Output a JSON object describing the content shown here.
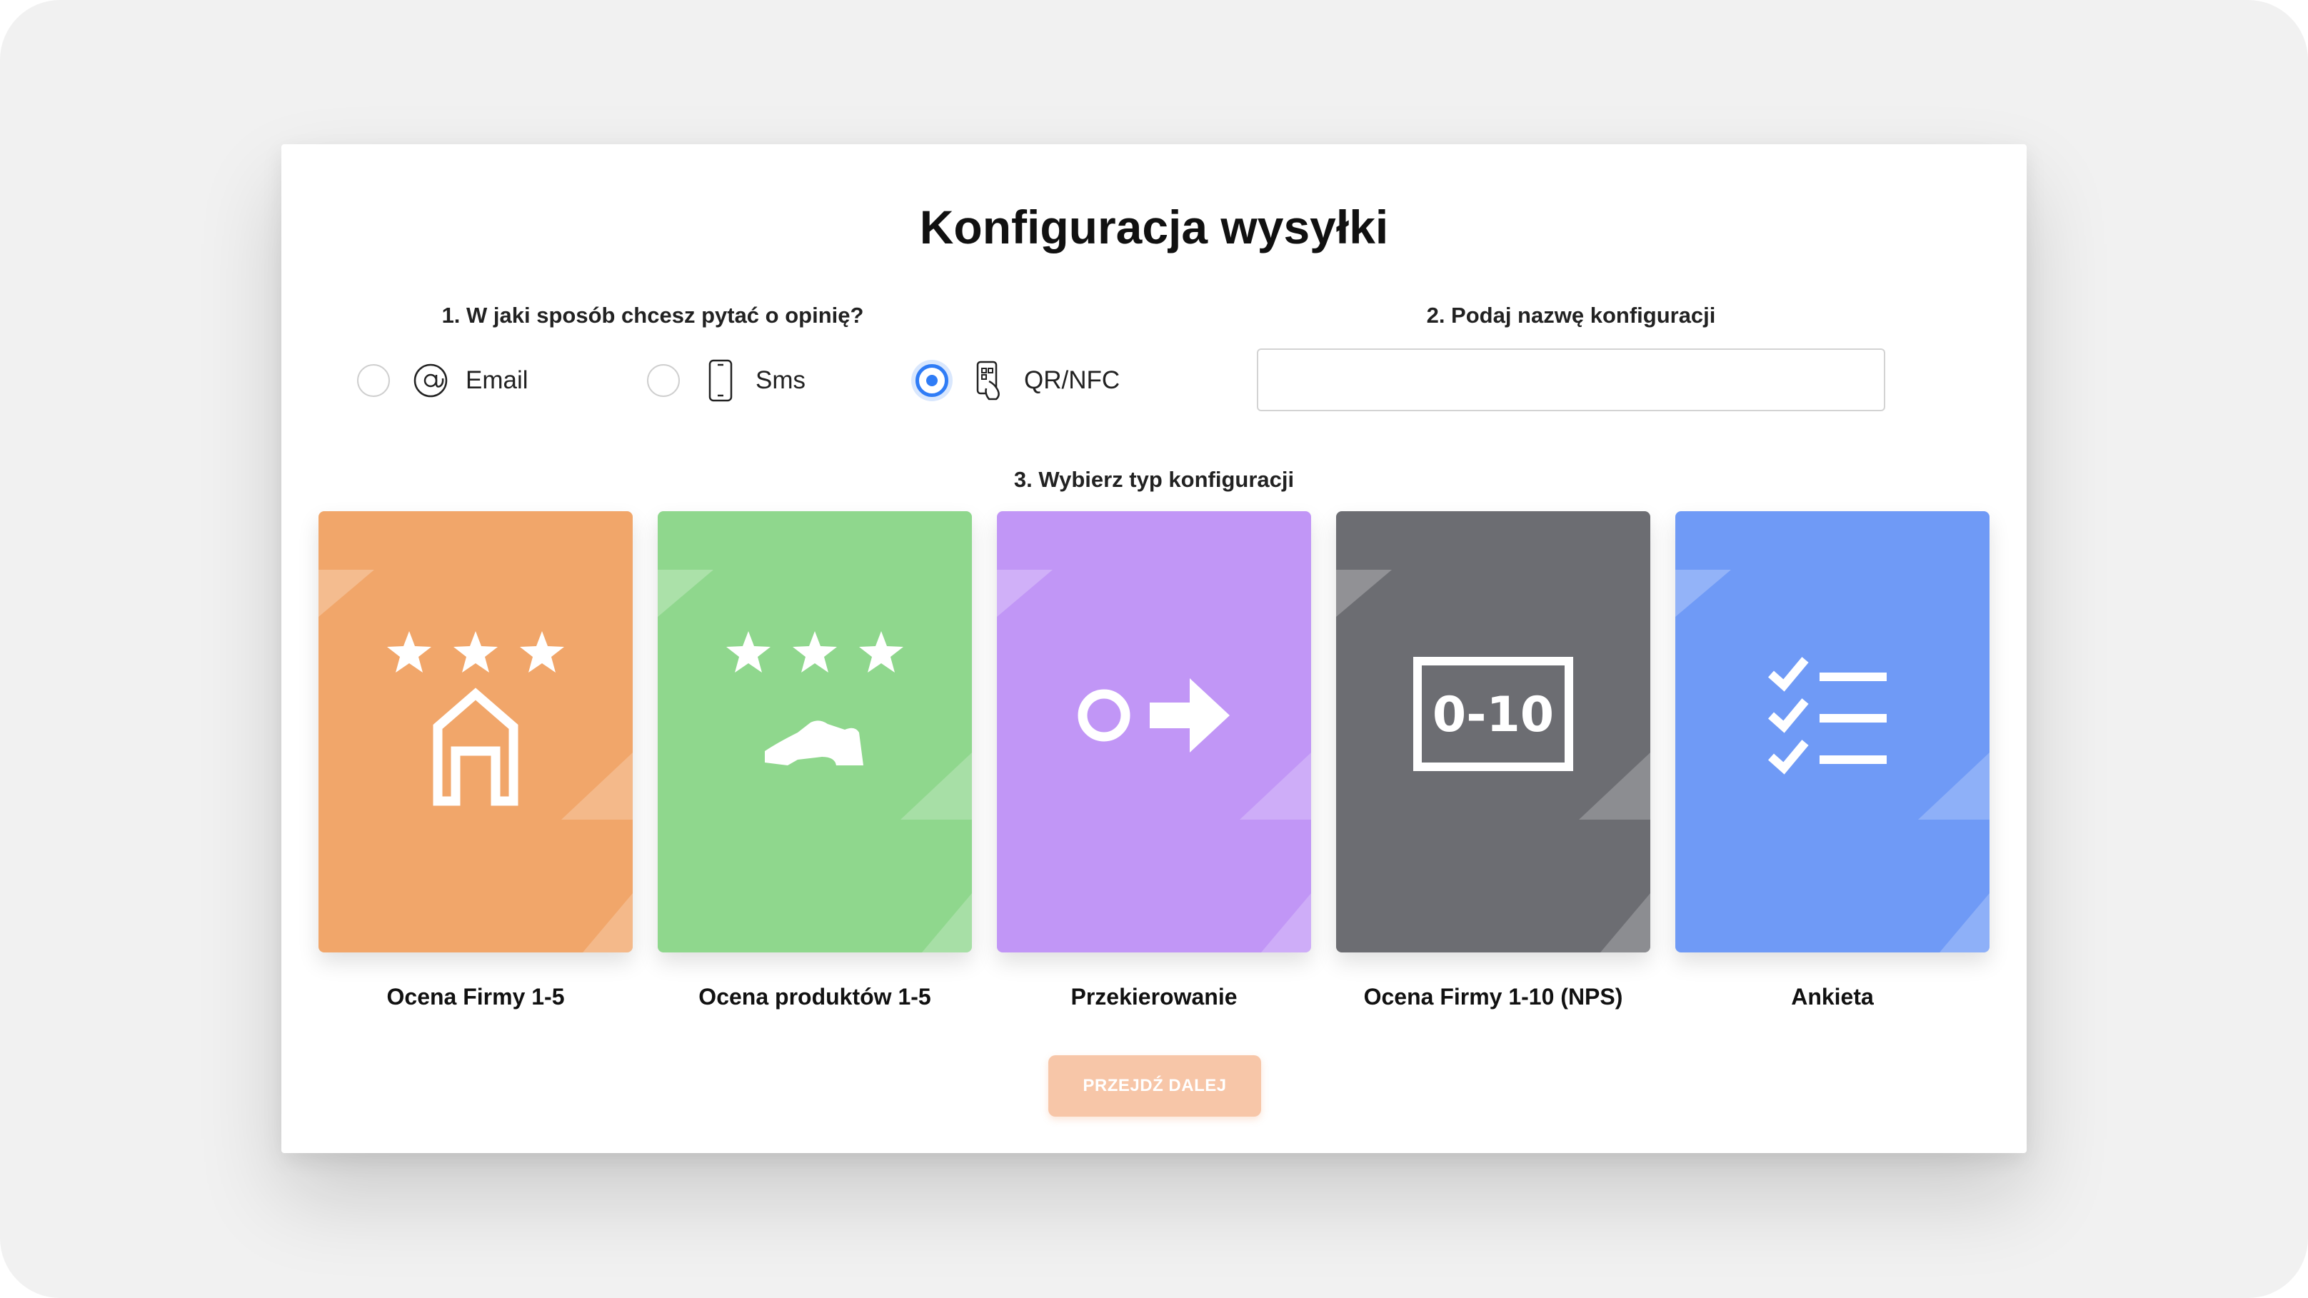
{
  "modal": {
    "title": "Konfiguracja wysyłki",
    "step1_label": "1. W jaki sposób chcesz pytać o opinię?",
    "step2_label": "2. Podaj nazwę konfiguracji",
    "step3_label": "3. Wybierz typ konfiguracji",
    "name_input": {
      "value": "",
      "placeholder": ""
    },
    "next_button": "PRZEJDŹ DALEJ"
  },
  "channels": [
    {
      "label": "Email",
      "icon": "at-sign-icon",
      "selected": false
    },
    {
      "label": "Sms",
      "icon": "smartphone-icon",
      "selected": false
    },
    {
      "label": "QR/NFC",
      "icon": "qr-phone-icon",
      "selected": true
    }
  ],
  "config_types": [
    {
      "label": "Ocena Firmy 1-5",
      "color": "#f1a66a",
      "icon": "stars-house-icon"
    },
    {
      "label": "Ocena produktów 1-5",
      "color": "#8fd78d",
      "icon": "stars-shoe-icon"
    },
    {
      "label": "Przekierowanie",
      "color": "#c196f6",
      "icon": "circle-arrow-icon",
      "icon_text": ""
    },
    {
      "label": "Ocena Firmy 1-10 (NPS)",
      "color": "#6c6d72",
      "icon": "nps-scale-icon",
      "icon_text": "0-10"
    },
    {
      "label": "Ankieta",
      "color": "#6f9af6",
      "icon": "checklist-icon"
    }
  ],
  "colors": {
    "accent": "#2f7cf6",
    "button_disabled": "#f7c6a8",
    "background": "#f1f1f1"
  }
}
